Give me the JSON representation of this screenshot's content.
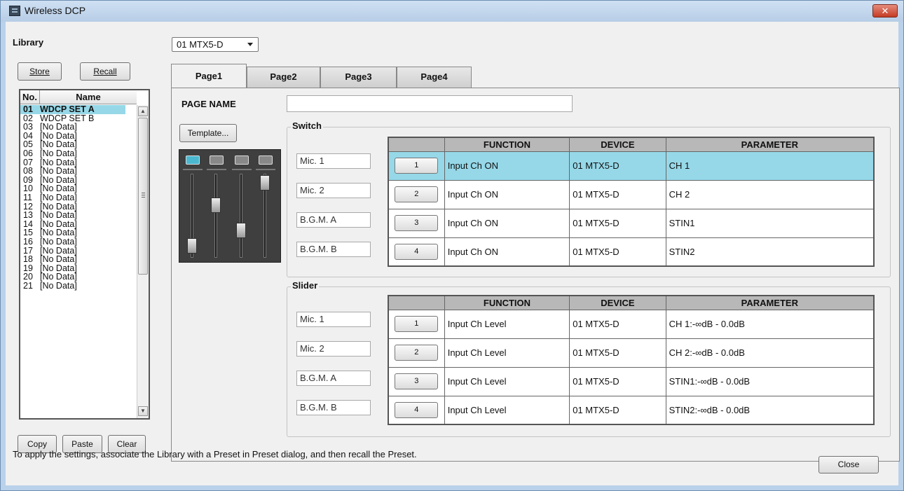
{
  "window": {
    "title": "Wireless DCP"
  },
  "library": {
    "label": "Library",
    "store_label": "Store",
    "recall_label": "Recall",
    "col_no": "No.",
    "col_name": "Name",
    "items": [
      {
        "no": "01",
        "name": "WDCP SET A"
      },
      {
        "no": "02",
        "name": "WDCP SET B"
      },
      {
        "no": "03",
        "name": "[No Data]"
      },
      {
        "no": "04",
        "name": "[No Data]"
      },
      {
        "no": "05",
        "name": "[No Data]"
      },
      {
        "no": "06",
        "name": "[No Data]"
      },
      {
        "no": "07",
        "name": "[No Data]"
      },
      {
        "no": "08",
        "name": "[No Data]"
      },
      {
        "no": "09",
        "name": "[No Data]"
      },
      {
        "no": "10",
        "name": "[No Data]"
      },
      {
        "no": "11",
        "name": "[No Data]"
      },
      {
        "no": "12",
        "name": "[No Data]"
      },
      {
        "no": "13",
        "name": "[No Data]"
      },
      {
        "no": "14",
        "name": "[No Data]"
      },
      {
        "no": "15",
        "name": "[No Data]"
      },
      {
        "no": "16",
        "name": "[No Data]"
      },
      {
        "no": "17",
        "name": "[No Data]"
      },
      {
        "no": "18",
        "name": "[No Data]"
      },
      {
        "no": "19",
        "name": "[No Data]"
      },
      {
        "no": "20",
        "name": "[No Data]"
      },
      {
        "no": "21",
        "name": "[No Data]"
      }
    ],
    "copy_label": "Copy",
    "paste_label": "Paste",
    "clear_label": "Clear"
  },
  "device_select": {
    "value": "01 MTX5-D"
  },
  "tabs": [
    {
      "label": "Page1",
      "active": true
    },
    {
      "label": "Page2",
      "active": false
    },
    {
      "label": "Page3",
      "active": false
    },
    {
      "label": "Page4",
      "active": false
    }
  ],
  "page": {
    "page_name_label": "PAGE NAME",
    "page_name_value": "",
    "template_label": "Template..."
  },
  "switch": {
    "title": "Switch",
    "headers": {
      "function": "FUNCTION",
      "device": "DEVICE",
      "parameter": "PARAMETER"
    },
    "rows": [
      {
        "name": "Mic. 1",
        "num": "1",
        "function": "Input Ch ON",
        "device": "01 MTX5-D",
        "parameter": "CH 1"
      },
      {
        "name": "Mic. 2",
        "num": "2",
        "function": "Input Ch ON",
        "device": "01 MTX5-D",
        "parameter": "CH 2"
      },
      {
        "name": "B.G.M. A",
        "num": "3",
        "function": "Input Ch ON",
        "device": "01 MTX5-D",
        "parameter": "STIN1"
      },
      {
        "name": "B.G.M. B",
        "num": "4",
        "function": "Input Ch ON",
        "device": "01 MTX5-D",
        "parameter": "STIN2"
      }
    ]
  },
  "slider": {
    "title": "Slider",
    "headers": {
      "function": "FUNCTION",
      "device": "DEVICE",
      "parameter": "PARAMETER"
    },
    "rows": [
      {
        "name": "Mic. 1",
        "num": "1",
        "function": "Input Ch Level",
        "device": "01 MTX5-D",
        "parameter": "CH 1:-∞dB - 0.0dB"
      },
      {
        "name": "Mic. 2",
        "num": "2",
        "function": "Input Ch Level",
        "device": "01 MTX5-D",
        "parameter": "CH 2:-∞dB - 0.0dB"
      },
      {
        "name": "B.G.M. A",
        "num": "3",
        "function": "Input Ch Level",
        "device": "01 MTX5-D",
        "parameter": "STIN1:-∞dB - 0.0dB"
      },
      {
        "name": "B.G.M. B",
        "num": "4",
        "function": "Input Ch Level",
        "device": "01 MTX5-D",
        "parameter": "STIN2:-∞dB - 0.0dB"
      }
    ]
  },
  "footer": {
    "hint": "To apply the settings, associate the Library with a Preset in Preset dialog, and then recall the Preset.",
    "close_label": "Close"
  }
}
